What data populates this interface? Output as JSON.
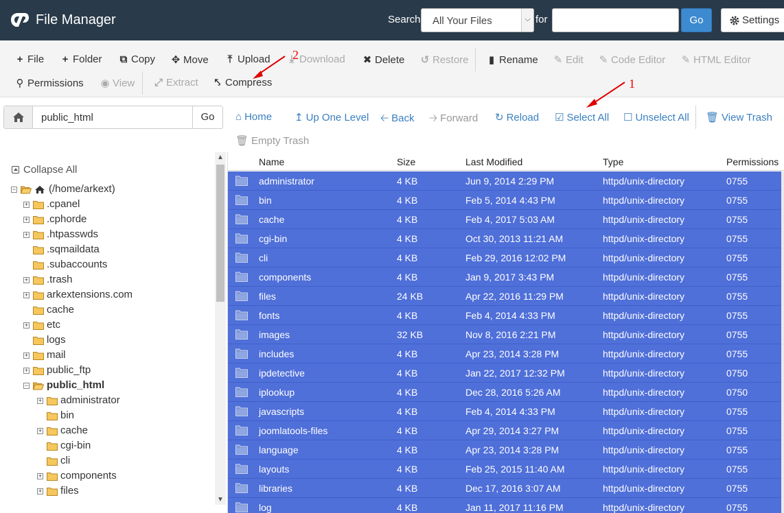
{
  "app": {
    "title": "File Manager"
  },
  "search": {
    "label": "Search",
    "scope": "All Your Files",
    "for_label": "for",
    "go": "Go"
  },
  "settings": {
    "label": "Settings"
  },
  "toolbar": {
    "file": "File",
    "folder": "Folder",
    "copy": "Copy",
    "move": "Move",
    "upload": "Upload",
    "download": "Download",
    "delete": "Delete",
    "restore": "Restore",
    "rename": "Rename",
    "edit": "Edit",
    "code_editor": "Code Editor",
    "html_editor": "HTML Editor",
    "permissions": "Permissions",
    "view": "View",
    "extract": "Extract",
    "compress": "Compress"
  },
  "path": {
    "value": "public_html",
    "go": "Go"
  },
  "nav": {
    "home": "Home",
    "up": "Up One Level",
    "back": "Back",
    "forward": "Forward",
    "reload": "Reload",
    "select_all": "Select All",
    "unselect_all": "Unselect All",
    "view_trash": "View Trash",
    "empty_trash": "Empty Trash"
  },
  "tree": {
    "collapse_all": "Collapse All",
    "root": "(/home/arkext)",
    "items": [
      ".cpanel",
      ".cphorde",
      ".htpasswds",
      ".sqmaildata",
      ".subaccounts",
      ".trash",
      "arkextensions.com",
      "cache",
      "etc",
      "logs",
      "mail",
      "public_ftp",
      "public_html",
      "administrator",
      "bin",
      "cache",
      "cgi-bin",
      "cli",
      "components",
      "files"
    ]
  },
  "table": {
    "columns": [
      "Name",
      "Size",
      "Last Modified",
      "Type",
      "Permissions"
    ],
    "rows": [
      [
        "administrator",
        "4 KB",
        "Jun 9, 2014 2:29 PM",
        "httpd/unix-directory",
        "0755"
      ],
      [
        "bin",
        "4 KB",
        "Feb 5, 2014 4:43 PM",
        "httpd/unix-directory",
        "0755"
      ],
      [
        "cache",
        "4 KB",
        "Feb 4, 2017 5:03 AM",
        "httpd/unix-directory",
        "0755"
      ],
      [
        "cgi-bin",
        "4 KB",
        "Oct 30, 2013 11:21 AM",
        "httpd/unix-directory",
        "0755"
      ],
      [
        "cli",
        "4 KB",
        "Feb 29, 2016 12:02 PM",
        "httpd/unix-directory",
        "0755"
      ],
      [
        "components",
        "4 KB",
        "Jan 9, 2017 3:43 PM",
        "httpd/unix-directory",
        "0755"
      ],
      [
        "files",
        "24 KB",
        "Apr 22, 2016 11:29 PM",
        "httpd/unix-directory",
        "0755"
      ],
      [
        "fonts",
        "4 KB",
        "Feb 4, 2014 4:33 PM",
        "httpd/unix-directory",
        "0755"
      ],
      [
        "images",
        "32 KB",
        "Nov 8, 2016 2:21 PM",
        "httpd/unix-directory",
        "0755"
      ],
      [
        "includes",
        "4 KB",
        "Apr 23, 2014 3:28 PM",
        "httpd/unix-directory",
        "0755"
      ],
      [
        "ipdetective",
        "4 KB",
        "Jan 22, 2017 12:32 PM",
        "httpd/unix-directory",
        "0750"
      ],
      [
        "iplookup",
        "4 KB",
        "Dec 28, 2016 5:26 AM",
        "httpd/unix-directory",
        "0750"
      ],
      [
        "javascripts",
        "4 KB",
        "Feb 4, 2014 4:33 PM",
        "httpd/unix-directory",
        "0755"
      ],
      [
        "joomlatools-files",
        "4 KB",
        "Apr 29, 2014 3:27 PM",
        "httpd/unix-directory",
        "0755"
      ],
      [
        "language",
        "4 KB",
        "Apr 23, 2014 3:28 PM",
        "httpd/unix-directory",
        "0755"
      ],
      [
        "layouts",
        "4 KB",
        "Feb 25, 2015 11:40 AM",
        "httpd/unix-directory",
        "0755"
      ],
      [
        "libraries",
        "4 KB",
        "Dec 17, 2016 3:07 AM",
        "httpd/unix-directory",
        "0755"
      ],
      [
        "log",
        "4 KB",
        "Jan 11, 2017 11:16 PM",
        "httpd/unix-directory",
        "0755"
      ]
    ]
  },
  "annotations": {
    "step1": "1",
    "step2": "2",
    "color": "#e00000"
  },
  "colors": {
    "header": "#293a4a",
    "accent": "#3d8ad0",
    "selected_row": "#4f6fd9",
    "link": "#3a7fc0"
  }
}
